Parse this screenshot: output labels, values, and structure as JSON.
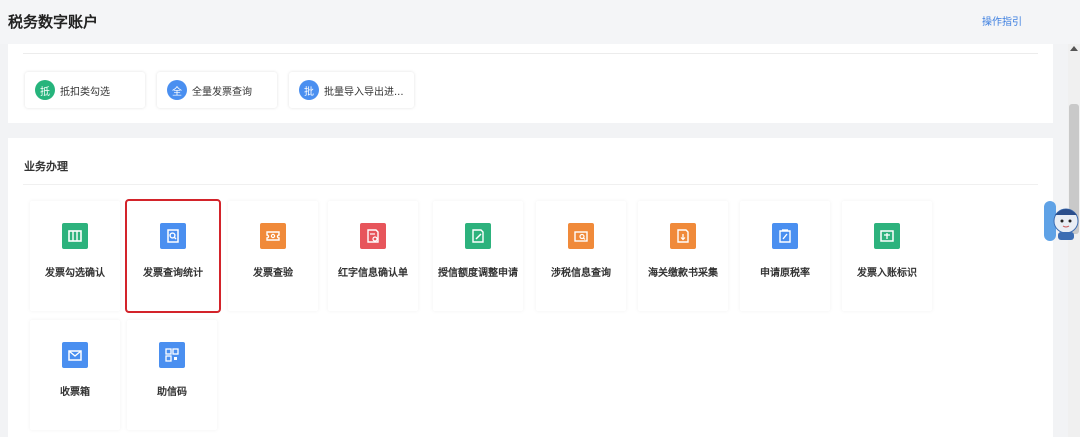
{
  "header": {
    "title": "税务数字账户",
    "help_link": "操作指引"
  },
  "quick_access": [
    {
      "badge": "抵",
      "label": "抵扣类勾选",
      "color": "#26b47c"
    },
    {
      "badge": "全",
      "label": "全量发票查询",
      "color": "#4a8ff0"
    },
    {
      "badge": "批",
      "label": "批量导入导出进...",
      "color": "#4a8ff0"
    }
  ],
  "business": {
    "title": "业务办理",
    "items": [
      {
        "label": "发票勾选确认",
        "icon": "invoice-check-icon",
        "color": "#2db27d"
      },
      {
        "label": "发票查询统计",
        "icon": "invoice-search-icon",
        "color": "#4a8ff0"
      },
      {
        "label": "发票查验",
        "icon": "invoice-verify-icon",
        "color": "#f08a3a"
      },
      {
        "label": "红字信息确认单",
        "icon": "red-letter-icon",
        "color": "#e7555b"
      },
      {
        "label": "授信额度调整申请",
        "icon": "credit-edit-icon",
        "color": "#2db27d"
      },
      {
        "label": "涉税信息查询",
        "icon": "tax-info-search-icon",
        "color": "#f08a3a"
      },
      {
        "label": "海关缴款书采集",
        "icon": "customs-collect-icon",
        "color": "#f08a3a"
      },
      {
        "label": "申请原税率",
        "icon": "apply-rate-icon",
        "color": "#4a8ff0"
      },
      {
        "label": "发票入账标识",
        "icon": "invoice-account-icon",
        "color": "#2db27d"
      },
      {
        "label": "收票箱",
        "icon": "mailbox-icon",
        "color": "#4a8ff0"
      },
      {
        "label": "助信码",
        "icon": "qr-code-icon",
        "color": "#4a8ff0"
      }
    ]
  }
}
